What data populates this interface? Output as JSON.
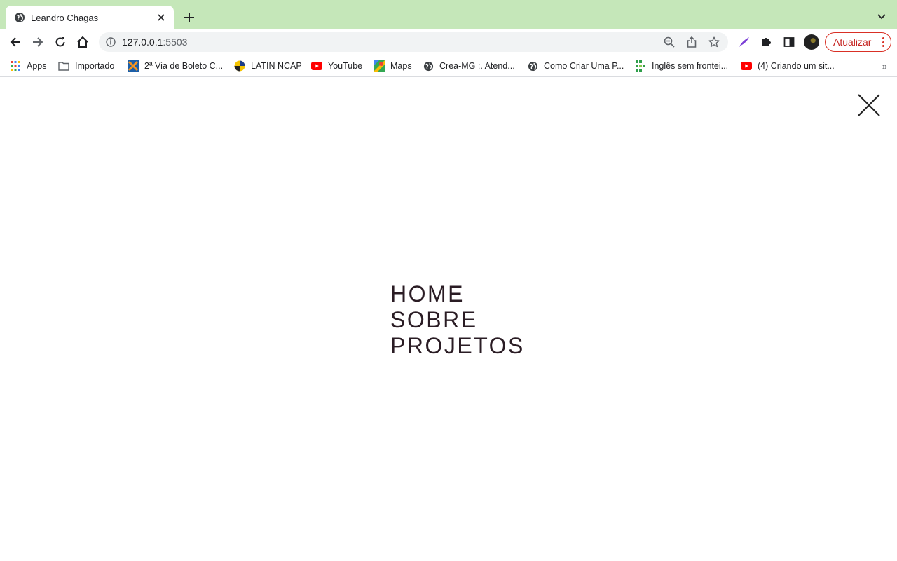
{
  "browser": {
    "tab": {
      "title": "Leandro Chagas",
      "favicon": "globe-icon"
    },
    "address": {
      "host": "127.0.0.1",
      "port": ":5503"
    },
    "update_label": "Atualizar",
    "colors": {
      "tabstrip": "#c5e7b9",
      "update_accent": "#d93025"
    }
  },
  "bookmarks": [
    {
      "label": "Apps",
      "icon": "apps-grid-icon"
    },
    {
      "label": "Importado",
      "icon": "folder-icon"
    },
    {
      "label": "2ª Via de Boleto C...",
      "icon": "caixa-icon"
    },
    {
      "label": "LATIN NCAP",
      "icon": "latin-ncap-icon"
    },
    {
      "label": "YouTube",
      "icon": "youtube-icon"
    },
    {
      "label": "Maps",
      "icon": "maps-icon"
    },
    {
      "label": "Crea-MG :. Atend...",
      "icon": "globe-icon"
    },
    {
      "label": "Como Criar Uma P...",
      "icon": "globe-icon"
    },
    {
      "label": "Inglês sem frontei...",
      "icon": "ingles-icon"
    },
    {
      "label": "(4) Criando um sit...",
      "icon": "youtube-icon"
    }
  ],
  "page": {
    "menu": [
      "HOME",
      "SOBRE",
      "PROJETOS"
    ],
    "text_color": "#2a1c24"
  }
}
